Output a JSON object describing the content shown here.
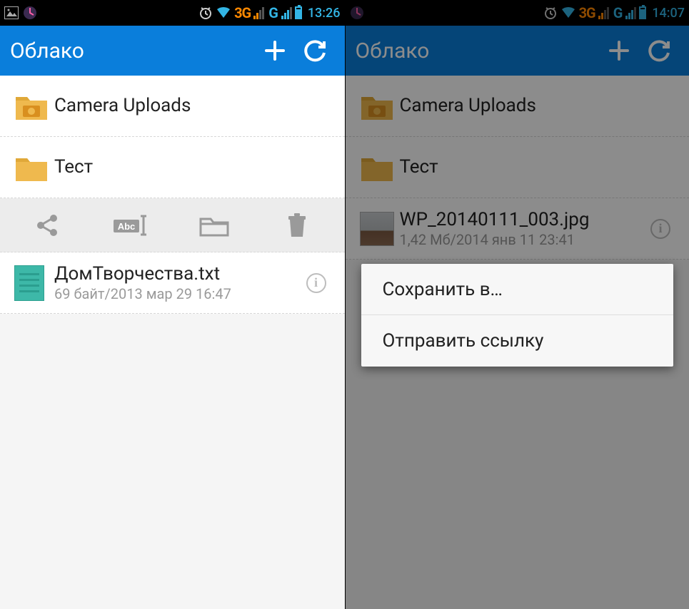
{
  "left": {
    "status": {
      "time": "13:26",
      "net1": "3G",
      "net2": "G"
    },
    "appbar": {
      "title": "Облако"
    },
    "items": {
      "camera": {
        "name": "Camera Uploads"
      },
      "test": {
        "name": "Тест"
      },
      "file": {
        "name": "ДомТворчества.txt",
        "meta": "69 байт/2013 мар 29 16:47"
      }
    }
  },
  "right": {
    "status": {
      "time": "14:07",
      "net1": "3G",
      "net2": "G"
    },
    "appbar": {
      "title": "Облако"
    },
    "items": {
      "camera": {
        "name": "Camera Uploads"
      },
      "test": {
        "name": "Тест"
      },
      "file": {
        "name": "WP_20140111_003.jpg",
        "meta": "1,42 Мб/2014 янв 11 23:41"
      }
    },
    "popup": {
      "save": "Сохранить в…",
      "sendlink": "Отправить ссылку"
    }
  }
}
